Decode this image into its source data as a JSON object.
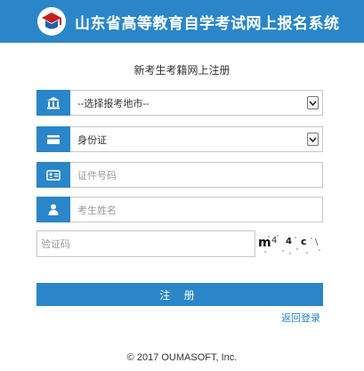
{
  "header": {
    "title": "山东省高等教育自学考试网上报名系统",
    "background": "#2a86c8"
  },
  "form": {
    "title": "新考生考籍网上注册",
    "region_select": {
      "value": "--选择报考地市--",
      "icon": "bank-icon"
    },
    "id_type_select": {
      "value": "身份证",
      "icon": "card-icon"
    },
    "id_number": {
      "placeholder": "证件号码",
      "icon": "id-card-icon"
    },
    "name": {
      "placeholder": "考生姓名",
      "icon": "user-icon"
    },
    "captcha": {
      "placeholder": "验证码",
      "chars": [
        "m",
        "4",
        "4",
        "c",
        "\\"
      ]
    },
    "register_label": "注 册",
    "back_label": "返回登录"
  },
  "footer": {
    "copyright": "© 2017 OUMASOFT, Inc."
  },
  "colors": {
    "accent": "#2a86c8",
    "border": "#c8c8c8"
  }
}
